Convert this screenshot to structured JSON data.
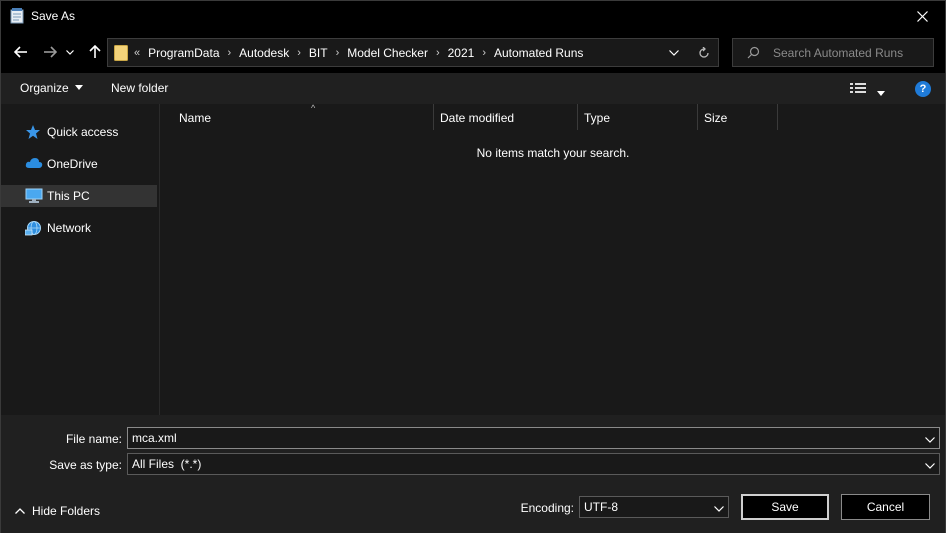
{
  "window": {
    "title": "Save As"
  },
  "address": {
    "crumbs": [
      "ProgramData",
      "Autodesk",
      "BIT",
      "Model Checker",
      "2021",
      "Automated Runs"
    ],
    "overflow": "«"
  },
  "search": {
    "placeholder": "Search Automated Runs"
  },
  "toolbar": {
    "organize_label": "Organize",
    "new_folder_label": "New folder"
  },
  "nav": {
    "items": [
      {
        "label": "Quick access",
        "icon": "star-icon",
        "selected": false
      },
      {
        "label": "OneDrive",
        "icon": "cloud-icon",
        "selected": false
      },
      {
        "label": "This PC",
        "icon": "computer-icon",
        "selected": true
      },
      {
        "label": "Network",
        "icon": "network-icon",
        "selected": false
      }
    ]
  },
  "columns": [
    {
      "label": "Name"
    },
    {
      "label": "Date modified"
    },
    {
      "label": "Type"
    },
    {
      "label": "Size"
    }
  ],
  "empty_message": "No items match your search.",
  "form": {
    "filename_label": "File name:",
    "filename_value": "mca.xml",
    "savetype_label": "Save as type:",
    "savetype_value": "All Files  (*.*)",
    "encoding_label": "Encoding:",
    "encoding_value": "UTF-8",
    "save_label": "Save",
    "cancel_label": "Cancel",
    "hide_folders_label": "Hide Folders"
  },
  "colors": {
    "accent": "#1f7bd8",
    "background": "#191919",
    "chrome": "#000000"
  }
}
